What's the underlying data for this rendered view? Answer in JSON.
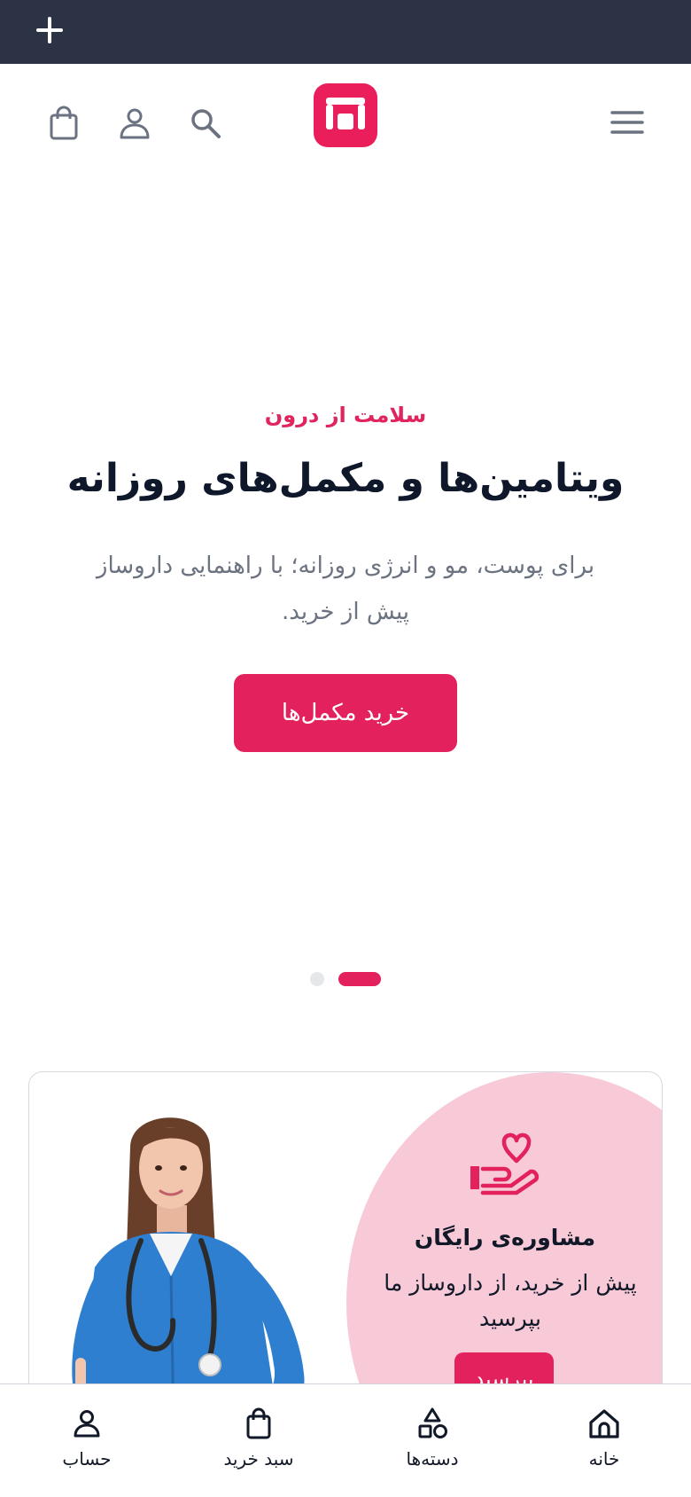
{
  "topbar": {
    "add_icon": "plus-icon"
  },
  "header": {
    "menu_icon": "hamburger-menu-icon",
    "logo_icon": "store-logo-icon",
    "search_icon": "search-icon",
    "account_icon": "user-icon",
    "cart_icon": "shopping-bag-icon"
  },
  "hero": {
    "eyebrow": "سلامت از درون",
    "title": "ویتامین‌ها و مکمل‌های روزانه",
    "description": "برای پوست، مو و انرژی روزانه؛ با راهنمایی داروساز پیش از خرید.",
    "cta_label": "خرید مکمل‌ها",
    "slides_count": 2,
    "active_slide": 2
  },
  "consult_card": {
    "icon": "heart-hand-icon",
    "title": "مشاوره‌ی رایگان",
    "text": "پیش از خرید، از داروساز ما بپرسید",
    "button_label": "بپرسید"
  },
  "bottom_nav": {
    "items": [
      {
        "label": "حساب",
        "icon": "user-icon"
      },
      {
        "label": "سبد خرید",
        "icon": "shopping-bag-icon"
      },
      {
        "label": "دسته‌ها",
        "icon": "shapes-icon"
      },
      {
        "label": "خانه",
        "icon": "home-icon"
      }
    ]
  },
  "colors": {
    "brand": "#e2215d",
    "topbar": "#2b3345",
    "card_pink": "#f8cad8",
    "muted_text": "#6b7280"
  }
}
